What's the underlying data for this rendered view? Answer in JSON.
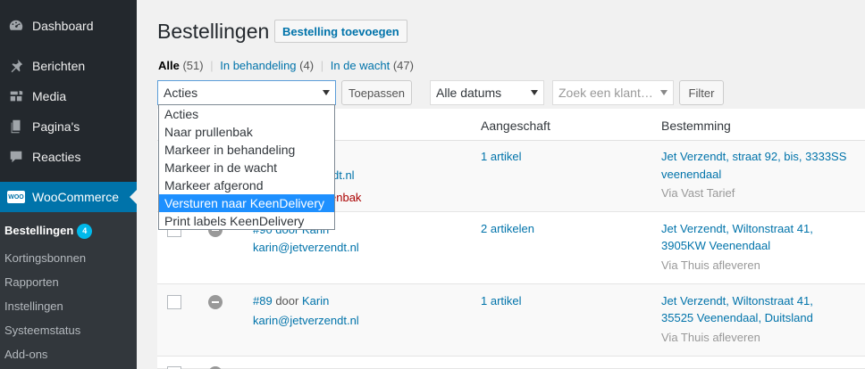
{
  "sidebar": {
    "items": [
      {
        "label": "Dashboard",
        "icon": "dashboard-icon"
      },
      {
        "label": "Berichten",
        "icon": "pin-icon"
      },
      {
        "label": "Media",
        "icon": "media-icon"
      },
      {
        "label": "Pagina's",
        "icon": "pages-icon"
      },
      {
        "label": "Reacties",
        "icon": "comments-icon"
      },
      {
        "label": "WooCommerce",
        "icon": "woo-icon"
      }
    ],
    "woo_logo_text": "WOO",
    "submenu": [
      {
        "label": "Bestellingen",
        "badge": "4"
      },
      {
        "label": "Kortingsbonnen"
      },
      {
        "label": "Rapporten"
      },
      {
        "label": "Instellingen"
      },
      {
        "label": "Systeemstatus"
      },
      {
        "label": "Add-ons"
      }
    ]
  },
  "header": {
    "title": "Bestellingen",
    "add_button": "Bestelling toevoegen"
  },
  "filters": {
    "all_label": "Alle",
    "all_count": "(51)",
    "processing_label": "In behandeling",
    "processing_count": "(4)",
    "onhold_label": "In de wacht",
    "onhold_count": "(47)",
    "separator": "|"
  },
  "toolbar": {
    "bulk_action_value": "Acties",
    "apply_label": "Toepassen",
    "dates_value": "Alle datums",
    "customer_placeholder": "Zoek een klant…",
    "filter_label": "Filter"
  },
  "bulk_actions_options": [
    "Acties",
    "Naar prullenbak",
    "Markeer in behandeling",
    "Markeer in de wacht",
    "Markeer afgerond",
    "Versturen naar KeenDelivery",
    "Print labels KeenDelivery"
  ],
  "bulk_actions_highlighted": "Versturen naar KeenDelivery",
  "table": {
    "columns": [
      "Aangeschaft",
      "Bestemming"
    ],
    "rows": [
      {
        "email_partial": "dt.nl",
        "trash_partial": "enbak",
        "items": "1 artikel",
        "address1": "Jet Verzendt, straat 92, bis, 3333SS",
        "address2": "veenendaal",
        "shipping": "Via Vast Tarief"
      },
      {
        "order_partial": "#90 door Karin",
        "email": "karin@jetverzendt.nl",
        "items": "2 artikelen",
        "address1": "Jet Verzendt, Wiltonstraat 41,",
        "address2": "3905KW Veenendaal",
        "shipping": "Via Thuis afleveren"
      },
      {
        "order_number": "#89",
        "order_by": "door",
        "customer": "Karin",
        "email": "karin@jetverzendt.nl",
        "items": "1 artikel",
        "address1": "Jet Verzendt, Wiltonstraat 41,",
        "address2": "35525 Veenendaal, Duitsland",
        "shipping": "Via Thuis afleveren"
      }
    ]
  },
  "colors": {
    "accent": "#0073aa",
    "sidebar_bg": "#23282d",
    "highlight": "#1e90ff",
    "badge": "#00b9eb"
  }
}
